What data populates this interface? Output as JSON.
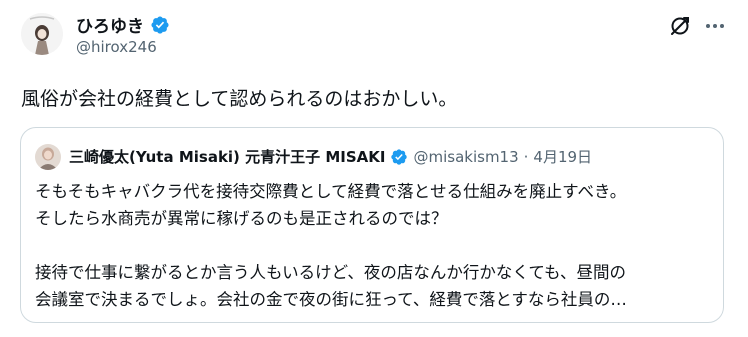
{
  "author": {
    "display_name": "ひろゆき",
    "handle": "@hirox246",
    "verified": true
  },
  "tweet": {
    "text": "風俗が会社の経費として認められるのはおかしい。"
  },
  "quoted_tweet": {
    "display_name": "三崎優太(Yuta Misaki) 元青汁王子 MISAKI",
    "handle": "@misakism13",
    "separator": "·",
    "date": "4月19日",
    "verified": true,
    "lines": [
      "そもそもキャバクラ代を接待交際費として経費で落とせる仕組みを廃止すべき。",
      "そしたら水商売が異常に稼げるのも是正されるのでは？",
      "",
      "接待で仕事に繋がるとか言う人もいるけど、夜の店なんか行かなくても、昼間の",
      "会議室で決まるでしょ。会社の金で夜の街に狂って、経費で落とすなら社員の…"
    ]
  },
  "icons": {
    "verified_color": "#1d9bf0",
    "grok": "grok-icon",
    "more": "more-icon"
  }
}
